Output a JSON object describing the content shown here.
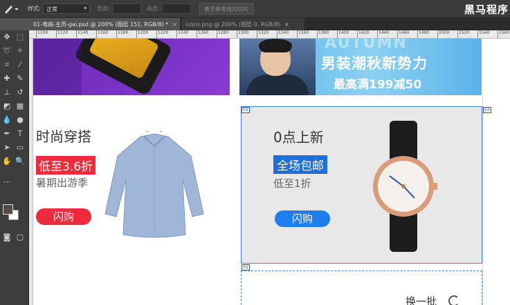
{
  "options_bar": {
    "style_label": "样式:",
    "style_value": "正常",
    "width_label": "宽度:",
    "height_label": "高度:",
    "slice_button": "基于参考线的切片",
    "brand": "黑马程序"
  },
  "tabs": [
    {
      "label": "01-电商-主页-gai.psd @ 200% (图层 151, RGB/8) *",
      "active": true
    },
    {
      "label": "icons.png @ 200% (图层 0, RGB/8)",
      "active": false
    }
  ],
  "ruler_ticks": [
    "1100",
    "1120",
    "1140",
    "1160",
    "1180",
    "1200",
    "1220",
    "1240",
    "1260",
    "1280",
    "1300",
    "1320",
    "1340",
    "1360",
    "1380",
    "1400",
    "1420",
    "1440",
    "1460",
    "1480",
    "1500",
    "1520",
    "1540",
    "1560"
  ],
  "banner_right": {
    "faint_text": "NEW AUTUMN",
    "line1": "男装潮秋新势力",
    "line2": "最高满199减50"
  },
  "card_left": {
    "title": "时尚穿搭",
    "tag": "低至3.6折",
    "subtitle": "暑期出游季",
    "button": "闪购"
  },
  "card_right": {
    "title": "0点上新",
    "tag": "全场包邮",
    "subtitle": "低至1折",
    "button": "闪购"
  },
  "slices": {
    "s1": "03",
    "s2": "04",
    "s3": "05"
  },
  "refresh_label": "换一批",
  "colors": {
    "accent_red": "#ee2b3c",
    "accent_blue": "#1e6fd9",
    "selection": "#4a7fe0"
  }
}
